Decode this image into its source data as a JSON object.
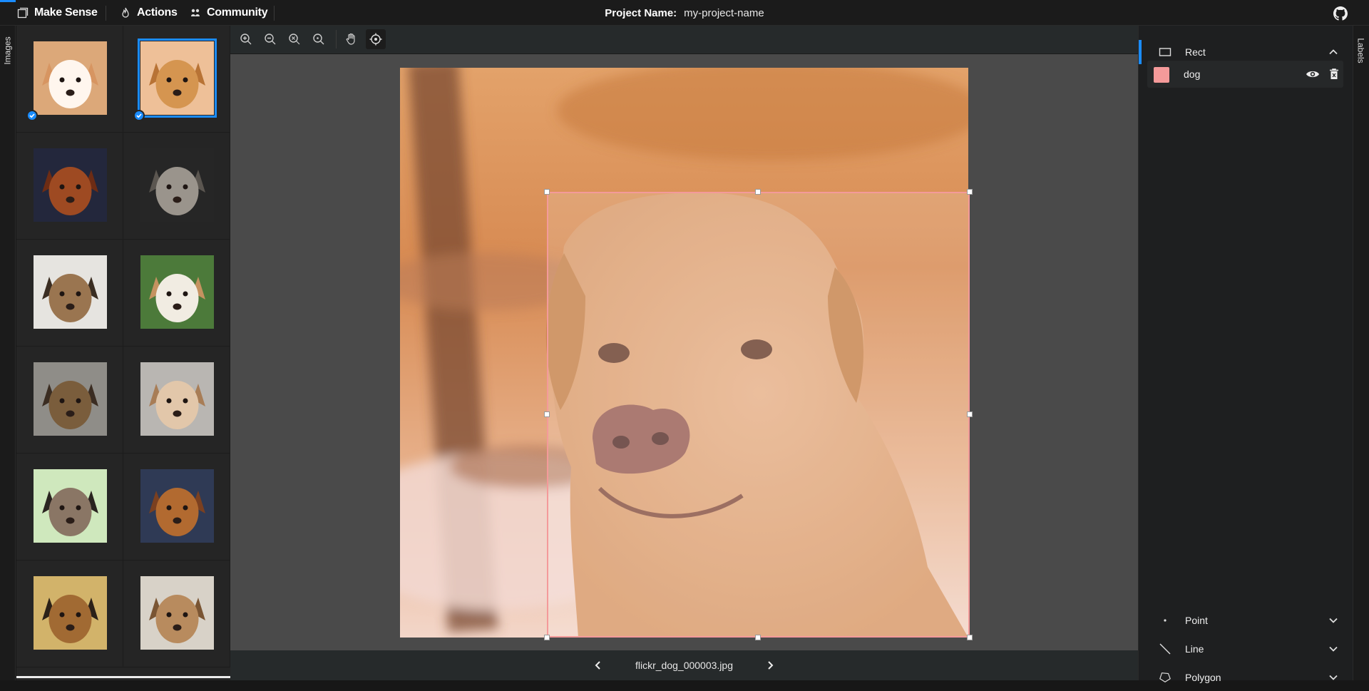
{
  "app": {
    "brand": "Make Sense",
    "menu": [
      {
        "label": "Actions",
        "icon": "flame-icon"
      },
      {
        "label": "Community",
        "icon": "people-icon"
      }
    ],
    "project_label": "Project Name:",
    "project_value": "my-project-name",
    "github_icon": "github-icon"
  },
  "sidebar_left": {
    "tab_label": "Images",
    "thumbnails": [
      {
        "name": "thumb-1",
        "checked": true,
        "selected": false,
        "bg": "#dca879",
        "fur": "#fff6ee",
        "ear": "#d79561"
      },
      {
        "name": "thumb-2",
        "checked": true,
        "selected": true,
        "bg": "#eec098",
        "fur": "#d59550",
        "ear": "#b87335"
      },
      {
        "name": "thumb-3",
        "checked": false,
        "selected": false,
        "bg": "#23273c",
        "fur": "#9e4a22",
        "ear": "#6d2c14"
      },
      {
        "name": "thumb-4",
        "checked": false,
        "selected": false,
        "bg": "#262626",
        "fur": "#9a948c",
        "ear": "#5b5650"
      },
      {
        "name": "thumb-5",
        "checked": false,
        "selected": false,
        "bg": "#e6e4e0",
        "fur": "#9a7550",
        "ear": "#3a2d22"
      },
      {
        "name": "thumb-6",
        "checked": false,
        "selected": false,
        "bg": "#4c7a3a",
        "fur": "#f1ece2",
        "ear": "#c59260"
      },
      {
        "name": "thumb-7",
        "checked": false,
        "selected": false,
        "bg": "#8f8d88",
        "fur": "#7a5d3c",
        "ear": "#3b2d22"
      },
      {
        "name": "thumb-8",
        "checked": false,
        "selected": false,
        "bg": "#b9b6b2",
        "fur": "#e2c7aa",
        "ear": "#a87d56"
      },
      {
        "name": "thumb-9",
        "checked": false,
        "selected": false,
        "bg": "#cfe8bd",
        "fur": "#8a7665",
        "ear": "#2a2420"
      },
      {
        "name": "thumb-10",
        "checked": false,
        "selected": false,
        "bg": "#2f3a55",
        "fur": "#b26a30",
        "ear": "#7b4020"
      },
      {
        "name": "thumb-11",
        "checked": false,
        "selected": false,
        "bg": "#d2b36a",
        "fur": "#a16a33",
        "ear": "#2b2118"
      },
      {
        "name": "thumb-12",
        "checked": false,
        "selected": false,
        "bg": "#d8d2c8",
        "fur": "#b88b5e",
        "ear": "#7a5533"
      }
    ]
  },
  "toolbar": {
    "buttons": [
      {
        "name": "zoom-in-icon",
        "active": false
      },
      {
        "name": "zoom-out-icon",
        "active": false
      },
      {
        "name": "zoom-fit-icon",
        "active": false
      },
      {
        "name": "zoom-max-icon",
        "active": false
      },
      {
        "name": "hand-pan-icon",
        "active": false
      },
      {
        "name": "crosshair-icon",
        "active": true
      }
    ]
  },
  "canvas": {
    "filename": "flickr_dog_000003.jpg",
    "annotation_color": "#f49a9a"
  },
  "sidebar_right": {
    "tab_label": "Labels",
    "rect_section": {
      "title": "Rect",
      "icon": "rectangle-icon",
      "expanded": true
    },
    "labels": [
      {
        "name": "dog",
        "color": "#f49a9a"
      }
    ],
    "sections": [
      {
        "title": "Point",
        "icon": "point-icon"
      },
      {
        "title": "Line",
        "icon": "line-icon"
      },
      {
        "title": "Polygon",
        "icon": "polygon-icon"
      }
    ]
  }
}
